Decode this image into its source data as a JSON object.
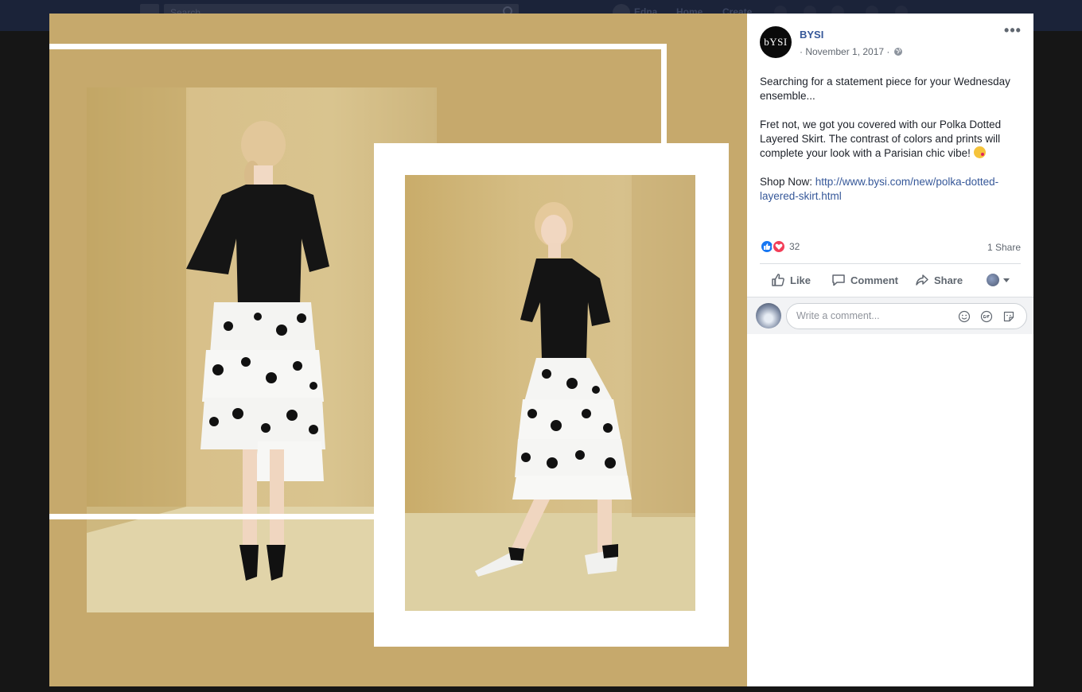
{
  "background": {
    "search_placeholder": "Search",
    "nav": [
      "Edna",
      "Home",
      "Create"
    ]
  },
  "post": {
    "page_name": "BYSI",
    "avatar_text": "bYSI",
    "date": "· November 1, 2017 ·",
    "paragraph1": "Searching for a statement piece for your Wednesday ensemble...",
    "paragraph2": "Fret not, we got you covered with our Polka Dotted Layered Skirt. The contrast of colors and prints will complete your look with a Parisian chic vibe!",
    "shop_label": "Shop Now: ",
    "shop_link": "http://www.bysi.com/new/polka-dotted-layered-skirt.html",
    "reaction_count": "32",
    "share_count": "1 Share"
  },
  "actions": {
    "like": "Like",
    "comment": "Comment",
    "share": "Share"
  },
  "comment_box": {
    "placeholder": "Write a comment..."
  },
  "colors": {
    "link": "#365899",
    "photo_background": "#c6a96c",
    "like_blue": "#1877f2",
    "love_red": "#f33e58"
  }
}
